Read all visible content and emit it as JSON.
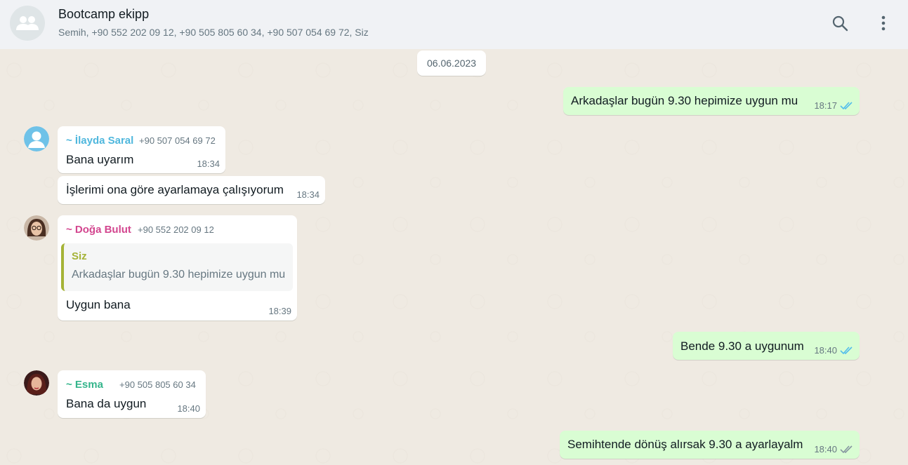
{
  "header": {
    "title": "Bootcamp ekipp",
    "members": "Semih, +90 552 202 09 12, +90 505 805 60 34, +90 507 054 69 72, Siz",
    "search_icon": "search-icon",
    "menu_icon": "menu-dots-icon"
  },
  "date_chip": "06.06.2023",
  "messages": {
    "m1": {
      "text": "Arkadaşlar bugün 9.30 hepimize uygun mu",
      "time": "18:17",
      "status": "read"
    },
    "m2": {
      "sender": "~ İlayda Saral",
      "phone": "+90 507 054 69 72",
      "text": "Bana uyarım",
      "time": "18:34"
    },
    "m3": {
      "text": "İşlerimi ona göre ayarlamaya çalışıyorum",
      "time": "18:34"
    },
    "m4": {
      "sender": "~ Doğa Bulut",
      "phone": "+90 552 202 09 12",
      "quote_author": "Siz",
      "quote_text": "Arkadaşlar bugün 9.30 hepimize uygun mu",
      "text": "Uygun bana",
      "time": "18:39"
    },
    "m5": {
      "text": "Bende 9.30 a uygunum",
      "time": "18:40",
      "status": "read"
    },
    "m6": {
      "sender": "~ Esma",
      "phone": "+90 505 805 60 34",
      "text": "Bana da uygun",
      "time": "18:40"
    },
    "m7": {
      "text": "Semihtende dönüş alırsak 9.30 a ayarlayalm",
      "time": "18:40",
      "status": "delivered"
    }
  },
  "colors": {
    "ilayda": "#4fb7dd",
    "doga": "#d3468f",
    "esma": "#35b58c",
    "quote_bar": "#a5b337",
    "read_tick": "#53bdeb",
    "delivered_tick": "#8696a0"
  }
}
